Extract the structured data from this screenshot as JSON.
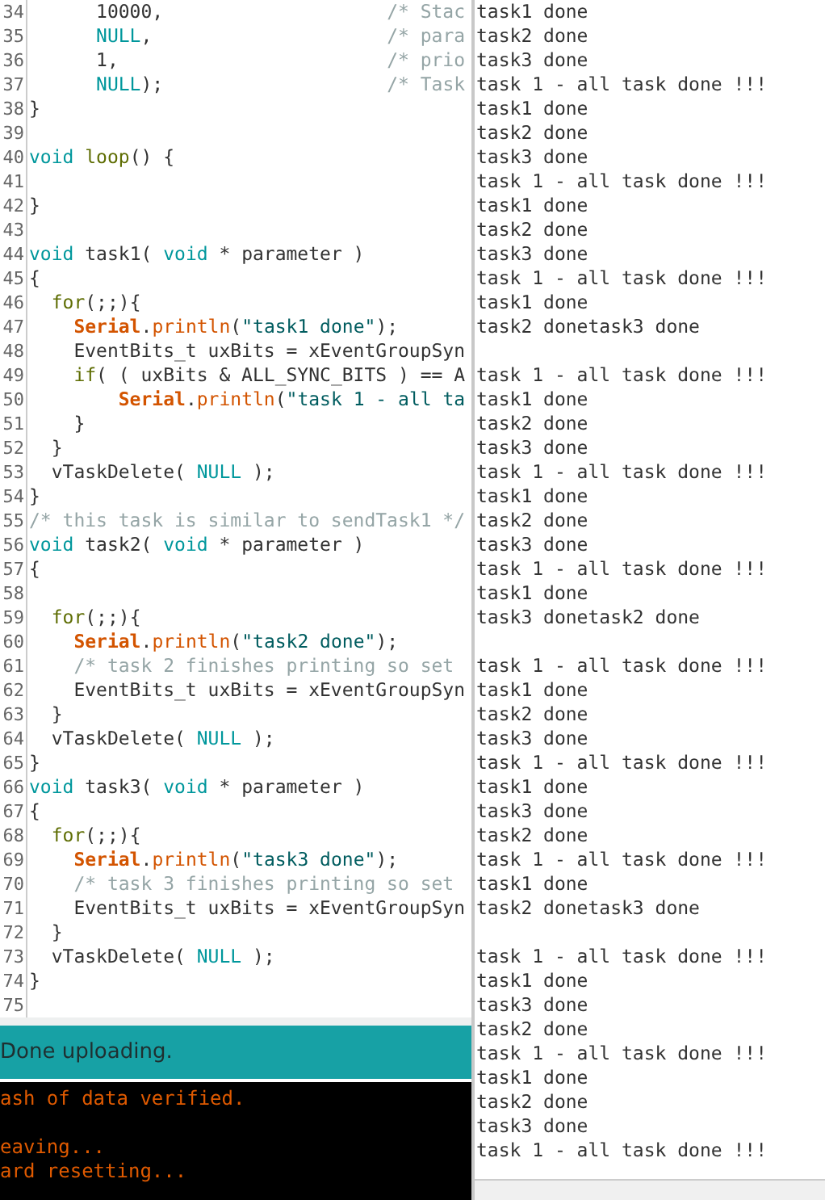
{
  "editor": {
    "lines": [
      {
        "number": "34",
        "tokens": [
          {
            "kind": "plain",
            "text": "      10000,                    "
          },
          {
            "kind": "comment",
            "text": "/* Stac"
          }
        ]
      },
      {
        "number": "35",
        "tokens": [
          {
            "kind": "constant",
            "text": "      NULL"
          },
          {
            "kind": "plain",
            "text": ",                     "
          },
          {
            "kind": "comment",
            "text": "/* para"
          }
        ]
      },
      {
        "number": "36",
        "tokens": [
          {
            "kind": "plain",
            "text": "      1,                        "
          },
          {
            "kind": "comment",
            "text": "/* prio"
          }
        ]
      },
      {
        "number": "37",
        "tokens": [
          {
            "kind": "constant",
            "text": "      NULL"
          },
          {
            "kind": "plain",
            "text": ");                    "
          },
          {
            "kind": "comment",
            "text": "/* Task"
          }
        ]
      },
      {
        "number": "38",
        "tokens": [
          {
            "kind": "plain",
            "text": "}"
          }
        ]
      },
      {
        "number": "39"
      },
      {
        "number": "40",
        "tokens": [
          {
            "kind": "type",
            "text": "void "
          },
          {
            "kind": "function",
            "text": "loop"
          },
          {
            "kind": "plain",
            "text": "() {"
          }
        ]
      },
      {
        "number": "41"
      },
      {
        "number": "42",
        "tokens": [
          {
            "kind": "plain",
            "text": "}"
          }
        ]
      },
      {
        "number": "43"
      },
      {
        "number": "44",
        "tokens": [
          {
            "kind": "type",
            "text": "void"
          },
          {
            "kind": "plain",
            "text": " task1( "
          },
          {
            "kind": "type",
            "text": "void"
          },
          {
            "kind": "plain",
            "text": " * parameter )"
          }
        ]
      },
      {
        "number": "45",
        "tokens": [
          {
            "kind": "plain",
            "text": "{"
          }
        ]
      },
      {
        "number": "46",
        "tokens": [
          {
            "kind": "function",
            "text": "  for"
          },
          {
            "kind": "plain",
            "text": "(;;){"
          }
        ]
      },
      {
        "number": "47",
        "tokens": [
          {
            "kind": "object",
            "text": "    Serial"
          },
          {
            "kind": "plain",
            "text": "."
          },
          {
            "kind": "method",
            "text": "println"
          },
          {
            "kind": "plain",
            "text": "("
          },
          {
            "kind": "string",
            "text": "\"task1 done\""
          },
          {
            "kind": "plain",
            "text": ");"
          }
        ]
      },
      {
        "number": "48",
        "tokens": [
          {
            "kind": "plain",
            "text": "    EventBits_t uxBits = xEventGroupSyn"
          }
        ]
      },
      {
        "number": "49",
        "tokens": [
          {
            "kind": "function",
            "text": "    if"
          },
          {
            "kind": "plain",
            "text": "( ( uxBits & ALL_SYNC_BITS ) == A"
          }
        ]
      },
      {
        "number": "50",
        "tokens": [
          {
            "kind": "object",
            "text": "        Serial"
          },
          {
            "kind": "plain",
            "text": "."
          },
          {
            "kind": "method",
            "text": "println"
          },
          {
            "kind": "plain",
            "text": "("
          },
          {
            "kind": "string",
            "text": "\"task 1 - all ta"
          }
        ]
      },
      {
        "number": "51",
        "tokens": [
          {
            "kind": "plain",
            "text": "    }"
          }
        ]
      },
      {
        "number": "52",
        "tokens": [
          {
            "kind": "plain",
            "text": "  }"
          }
        ]
      },
      {
        "number": "53",
        "tokens": [
          {
            "kind": "plain",
            "text": "  vTaskDelete( "
          },
          {
            "kind": "constant",
            "text": "NULL"
          },
          {
            "kind": "plain",
            "text": " );"
          }
        ]
      },
      {
        "number": "54",
        "tokens": [
          {
            "kind": "plain",
            "text": "}"
          }
        ]
      },
      {
        "number": "55",
        "tokens": [
          {
            "kind": "comment",
            "text": "/* this task is similar to sendTask1 */"
          }
        ]
      },
      {
        "number": "56",
        "tokens": [
          {
            "kind": "type",
            "text": "void"
          },
          {
            "kind": "plain",
            "text": " task2( "
          },
          {
            "kind": "type",
            "text": "void"
          },
          {
            "kind": "plain",
            "text": " * parameter )"
          }
        ]
      },
      {
        "number": "57",
        "tokens": [
          {
            "kind": "plain",
            "text": "{"
          }
        ]
      },
      {
        "number": "58"
      },
      {
        "number": "59",
        "tokens": [
          {
            "kind": "function",
            "text": "  for"
          },
          {
            "kind": "plain",
            "text": "(;;){"
          }
        ]
      },
      {
        "number": "60",
        "tokens": [
          {
            "kind": "object",
            "text": "    Serial"
          },
          {
            "kind": "plain",
            "text": "."
          },
          {
            "kind": "method",
            "text": "println"
          },
          {
            "kind": "plain",
            "text": "("
          },
          {
            "kind": "string",
            "text": "\"task2 done\""
          },
          {
            "kind": "plain",
            "text": ");"
          }
        ]
      },
      {
        "number": "61",
        "tokens": [
          {
            "kind": "comment",
            "text": "    /* task 2 finishes printing so set"
          }
        ]
      },
      {
        "number": "62",
        "tokens": [
          {
            "kind": "plain",
            "text": "    EventBits_t uxBits = xEventGroupSyn"
          }
        ]
      },
      {
        "number": "63",
        "tokens": [
          {
            "kind": "plain",
            "text": "  }"
          }
        ]
      },
      {
        "number": "64",
        "tokens": [
          {
            "kind": "plain",
            "text": "  vTaskDelete( "
          },
          {
            "kind": "constant",
            "text": "NULL"
          },
          {
            "kind": "plain",
            "text": " );"
          }
        ]
      },
      {
        "number": "65",
        "tokens": [
          {
            "kind": "plain",
            "text": "}"
          }
        ]
      },
      {
        "number": "66",
        "tokens": [
          {
            "kind": "type",
            "text": "void"
          },
          {
            "kind": "plain",
            "text": " task3( "
          },
          {
            "kind": "type",
            "text": "void"
          },
          {
            "kind": "plain",
            "text": " * parameter )"
          }
        ]
      },
      {
        "number": "67",
        "tokens": [
          {
            "kind": "plain",
            "text": "{"
          }
        ]
      },
      {
        "number": "68",
        "tokens": [
          {
            "kind": "function",
            "text": "  for"
          },
          {
            "kind": "plain",
            "text": "(;;){"
          }
        ]
      },
      {
        "number": "69",
        "tokens": [
          {
            "kind": "object",
            "text": "    Serial"
          },
          {
            "kind": "plain",
            "text": "."
          },
          {
            "kind": "method",
            "text": "println"
          },
          {
            "kind": "plain",
            "text": "("
          },
          {
            "kind": "string",
            "text": "\"task3 done\""
          },
          {
            "kind": "plain",
            "text": ");"
          }
        ]
      },
      {
        "number": "70",
        "tokens": [
          {
            "kind": "comment",
            "text": "    /* task 3 finishes printing so set"
          }
        ]
      },
      {
        "number": "71",
        "tokens": [
          {
            "kind": "plain",
            "text": "    EventBits_t uxBits = xEventGroupSyn"
          }
        ]
      },
      {
        "number": "72",
        "tokens": [
          {
            "kind": "plain",
            "text": "  }"
          }
        ]
      },
      {
        "number": "73",
        "tokens": [
          {
            "kind": "plain",
            "text": "  vTaskDelete( "
          },
          {
            "kind": "constant",
            "text": "NULL"
          },
          {
            "kind": "plain",
            "text": " );"
          }
        ]
      },
      {
        "number": "74",
        "tokens": [
          {
            "kind": "plain",
            "text": "}"
          }
        ]
      },
      {
        "number": "75"
      }
    ]
  },
  "status_bar": {
    "text": "Done uploading."
  },
  "console": {
    "lines": [
      {
        "kind": "text",
        "text": "ash of data verified."
      },
      {
        "kind": "blank"
      },
      {
        "kind": "text",
        "text": "eaving..."
      },
      {
        "kind": "text",
        "text": "ard resetting..."
      }
    ]
  },
  "serial_monitor": {
    "lines": [
      {
        "kind": "text",
        "text": "task1 done"
      },
      {
        "kind": "text",
        "text": "task2 done"
      },
      {
        "kind": "text",
        "text": "task3 done"
      },
      {
        "kind": "text",
        "text": "task 1 - all task done !!!"
      },
      {
        "kind": "text",
        "text": "task1 done"
      },
      {
        "kind": "text",
        "text": "task2 done"
      },
      {
        "kind": "text",
        "text": "task3 done"
      },
      {
        "kind": "text",
        "text": "task 1 - all task done !!!"
      },
      {
        "kind": "text",
        "text": "task1 done"
      },
      {
        "kind": "text",
        "text": "task2 done"
      },
      {
        "kind": "text",
        "text": "task3 done"
      },
      {
        "kind": "text",
        "text": "task 1 - all task done !!!"
      },
      {
        "kind": "text",
        "text": "task1 done"
      },
      {
        "kind": "text",
        "text": "task2 donetask3 done"
      },
      {
        "kind": "blank"
      },
      {
        "kind": "text",
        "text": "task 1 - all task done !!!"
      },
      {
        "kind": "text",
        "text": "task1 done"
      },
      {
        "kind": "text",
        "text": "task2 done"
      },
      {
        "kind": "text",
        "text": "task3 done"
      },
      {
        "kind": "text",
        "text": "task 1 - all task done !!!"
      },
      {
        "kind": "text",
        "text": "task1 done"
      },
      {
        "kind": "text",
        "text": "task2 done"
      },
      {
        "kind": "text",
        "text": "task3 done"
      },
      {
        "kind": "text",
        "text": "task 1 - all task done !!!"
      },
      {
        "kind": "text",
        "text": "task1 done"
      },
      {
        "kind": "text",
        "text": "task3 donetask2 done"
      },
      {
        "kind": "blank"
      },
      {
        "kind": "text",
        "text": "task 1 - all task done !!!"
      },
      {
        "kind": "text",
        "text": "task1 done"
      },
      {
        "kind": "text",
        "text": "task2 done"
      },
      {
        "kind": "text",
        "text": "task3 done"
      },
      {
        "kind": "text",
        "text": "task 1 - all task done !!!"
      },
      {
        "kind": "text",
        "text": "task1 done"
      },
      {
        "kind": "text",
        "text": "task3 done"
      },
      {
        "kind": "text",
        "text": "task2 done"
      },
      {
        "kind": "text",
        "text": "task 1 - all task done !!!"
      },
      {
        "kind": "text",
        "text": "task1 done"
      },
      {
        "kind": "text",
        "text": "task2 donetask3 done"
      },
      {
        "kind": "blank"
      },
      {
        "kind": "text",
        "text": "task 1 - all task done !!!"
      },
      {
        "kind": "text",
        "text": "task1 done"
      },
      {
        "kind": "text",
        "text": "task3 done"
      },
      {
        "kind": "text",
        "text": "task2 done"
      },
      {
        "kind": "text",
        "text": "task 1 - all task done !!!"
      },
      {
        "kind": "text",
        "text": "task1 done"
      },
      {
        "kind": "text",
        "text": "task2 done"
      },
      {
        "kind": "text",
        "text": "task3 done"
      },
      {
        "kind": "text",
        "text": "task 1 - all task done !!!"
      }
    ]
  }
}
